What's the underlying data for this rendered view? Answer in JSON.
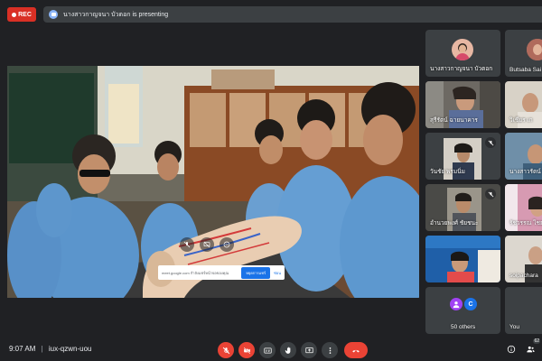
{
  "header": {
    "rec_label": "REC",
    "presenting_text": "นางสาวกาญจนา บัวตอก is presenting"
  },
  "shared_screen": {
    "notification": {
      "url_text": "meet.google.com กำลังแชร์หน้าจอของคุณ",
      "stop_label": "หยุดการแชร์",
      "hide_label": "ซ่อน"
    }
  },
  "participants": [
    {
      "name": "นางสาวกาญจนา บัวตอก",
      "muted": false,
      "kind": "avatar-photo"
    },
    {
      "name": "Butsaba Sai",
      "muted": false,
      "kind": "avatar-photo"
    },
    {
      "name": "สุรีรัตน์ ฉายนาคาร",
      "muted": false,
      "kind": "video"
    },
    {
      "name": "วิเชียร เก",
      "muted": false,
      "kind": "video"
    },
    {
      "name": "วันชัย พรมนิ่ม",
      "muted": true,
      "kind": "video"
    },
    {
      "name": "นางสาวรัตน์",
      "muted": false,
      "kind": "video"
    },
    {
      "name": "อำนวยพงศ์ ชัยชนะ",
      "muted": true,
      "kind": "video"
    },
    {
      "name": "รัชวรรณ ไชย",
      "muted": false,
      "kind": "video"
    },
    {
      "name": "",
      "muted": false,
      "kind": "video"
    },
    {
      "name": "soipachara",
      "muted": false,
      "kind": "video"
    },
    {
      "name": "50 others",
      "muted": false,
      "kind": "others",
      "avatar_letter": "C"
    },
    {
      "name": "You",
      "muted": false,
      "kind": "self"
    }
  ],
  "footer": {
    "time": "9:07 AM",
    "separator": "|",
    "meeting_code": "iux-qzwn-uou",
    "people_count": "62"
  },
  "colors": {
    "background": "#202124",
    "tile": "#3c4043",
    "danger": "#ea4335",
    "accent": "#1a73e8"
  },
  "icons": [
    "mic-off-icon",
    "camera-off-icon",
    "captions-icon",
    "raise-hand-icon",
    "present-icon",
    "more-icon",
    "end-call-icon",
    "info-icon",
    "people-icon",
    "chat-icon"
  ]
}
